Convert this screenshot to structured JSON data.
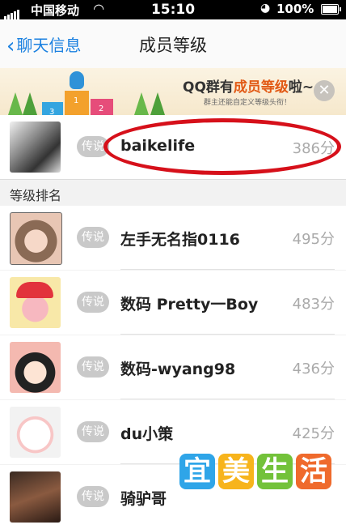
{
  "status_bar": {
    "carrier": "中国移动",
    "time": "15:10",
    "battery": "100%",
    "wifi_icon": "wifi-icon",
    "lock_icon": "rotation-lock-icon"
  },
  "nav": {
    "back_label": "聊天信息",
    "title": "成员等级"
  },
  "banner": {
    "headline_pre": "QQ群有",
    "headline_highlight": "成员等级",
    "headline_post": "啦~",
    "subtitle": "群主还能自定义等级头衔！",
    "close_symbol": "✕",
    "podium": [
      "3",
      "1",
      "2"
    ]
  },
  "me": {
    "badge": "传说",
    "name": "baikelife",
    "score": "386分"
  },
  "section_title": "等级排名",
  "members": [
    {
      "badge": "传说",
      "name": "左手无名指0116",
      "score": "495分"
    },
    {
      "badge": "传说",
      "name": "数码  Pretty一Boy",
      "score": "483分"
    },
    {
      "badge": "传说",
      "name": "数码-wyang98",
      "score": "436分"
    },
    {
      "badge": "传说",
      "name": "du小策",
      "score": "425分"
    },
    {
      "badge": "传说",
      "name": "骑驴哥",
      "score": ""
    }
  ],
  "watermark": [
    "宜",
    "美",
    "生",
    "活"
  ],
  "colors": {
    "accent": "#1a80e0",
    "annotation": "#d6101a",
    "badge": "#c9c9c9"
  }
}
